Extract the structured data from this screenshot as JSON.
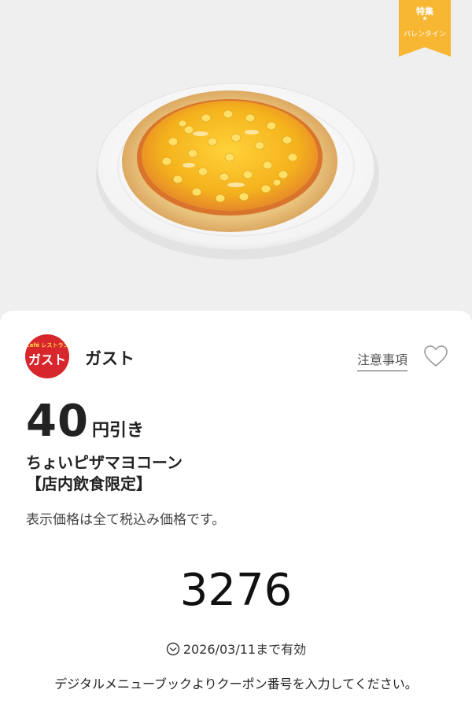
{
  "ribbon": {
    "line1": "特集",
    "star": "★",
    "line2": "バレンタイン",
    "color": "#f7b733"
  },
  "coupon": {
    "brand_logo_small": "Café レストラン",
    "brand_logo_main": "ガスト",
    "brand_name": "ガスト",
    "notes_link": "注意事項",
    "discount_value": "40",
    "discount_unit": "円引き",
    "product_name": "ちょいピザマヨコーン",
    "product_note": "【店内飲食限定】",
    "tax_note": "表示価格は全て税込み価格です。",
    "code": "3276",
    "validity": "2026/03/11まで有効",
    "instructions": "デジタルメニューブックよりクーポン番号を入力してください。"
  },
  "icons": {
    "favorite": "heart-outline-icon",
    "clock": "clock-icon"
  },
  "colors": {
    "brand_red": "#d8262d",
    "ribbon": "#f7b733"
  }
}
